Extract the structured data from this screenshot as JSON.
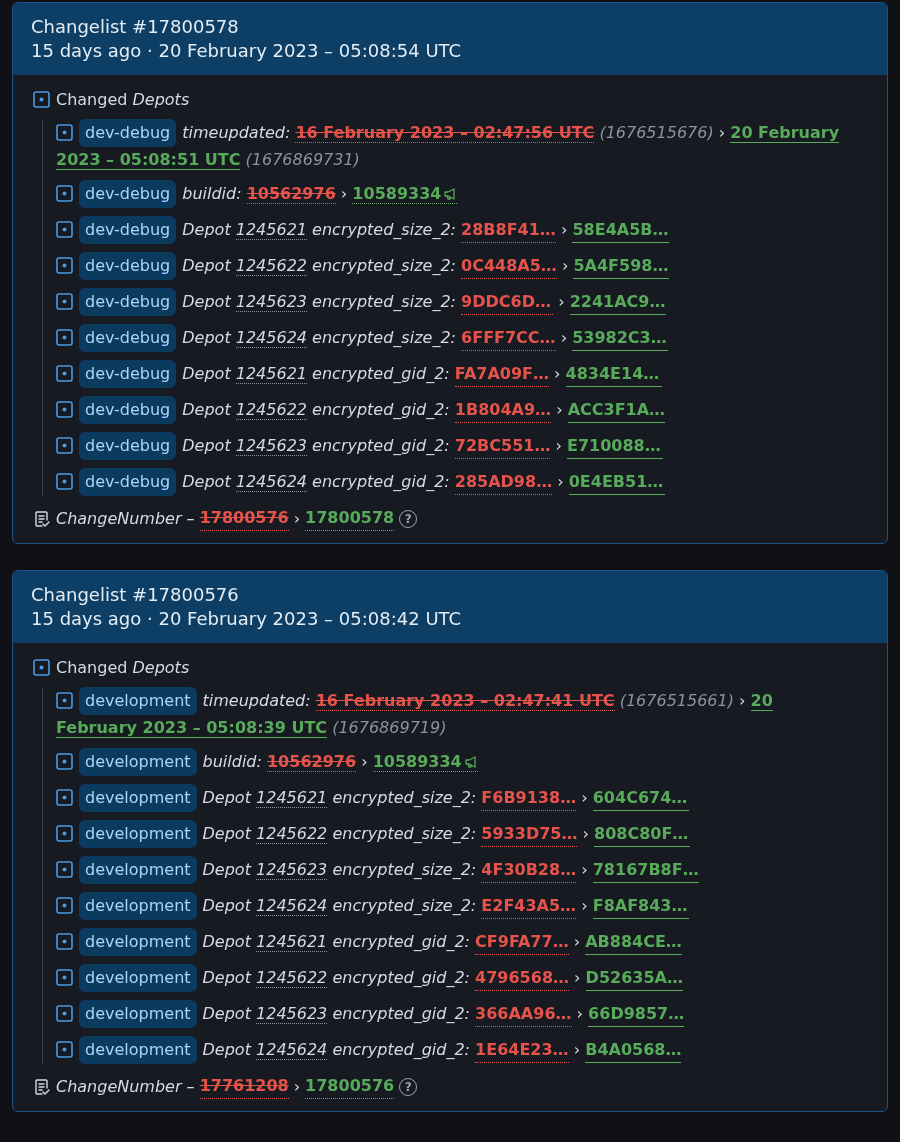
{
  "changelists": [
    {
      "title": "Changelist #17800578",
      "subtitle": "15 days ago · 20 February 2023 – 05:08:54 UTC",
      "section": {
        "label": "Changed",
        "label_italic": "Depots"
      },
      "changes": [
        {
          "kind": "time",
          "branch": "dev-debug",
          "key": "timeupdated:",
          "old": "16 February 2023 – 02:47:56 UTC",
          "old_note": "(1676515676)",
          "arrow": "›",
          "new": "20 February 2023 – 05:08:51 UTC",
          "new_note": "(1676869731)"
        },
        {
          "kind": "build",
          "branch": "dev-debug",
          "key": "buildid:",
          "old": "10562976",
          "arrow": "›",
          "new": "10589334"
        },
        {
          "kind": "depot",
          "branch": "dev-debug",
          "prefix": "Depot",
          "depot": "1245621",
          "key": "encrypted_size_2:",
          "old": "28B8F41…",
          "arrow": "›",
          "new": "58E4A5B…"
        },
        {
          "kind": "depot",
          "branch": "dev-debug",
          "prefix": "Depot",
          "depot": "1245622",
          "key": "encrypted_size_2:",
          "old": "0C448A5…",
          "arrow": "›",
          "new": "5A4F598…"
        },
        {
          "kind": "depot",
          "branch": "dev-debug",
          "prefix": "Depot",
          "depot": "1245623",
          "key": "encrypted_size_2:",
          "old": "9DDC6D…",
          "arrow": "›",
          "new": "2241AC9…"
        },
        {
          "kind": "depot",
          "branch": "dev-debug",
          "prefix": "Depot",
          "depot": "1245624",
          "key": "encrypted_size_2:",
          "old": "6FFF7CC…",
          "arrow": "›",
          "new": "53982C3…"
        },
        {
          "kind": "depot",
          "branch": "dev-debug",
          "prefix": "Depot",
          "depot": "1245621",
          "key": "encrypted_gid_2:",
          "old": "FA7A09F…",
          "arrow": "›",
          "new": "4834E14…"
        },
        {
          "kind": "depot",
          "branch": "dev-debug",
          "prefix": "Depot",
          "depot": "1245622",
          "key": "encrypted_gid_2:",
          "old": "1B804A9…",
          "arrow": "›",
          "new": "ACC3F1A…"
        },
        {
          "kind": "depot",
          "branch": "dev-debug",
          "prefix": "Depot",
          "depot": "1245623",
          "key": "encrypted_gid_2:",
          "old": "72BC551…",
          "arrow": "›",
          "new": "E710088…"
        },
        {
          "kind": "depot",
          "branch": "dev-debug",
          "prefix": "Depot",
          "depot": "1245624",
          "key": "encrypted_gid_2:",
          "old": "285AD98…",
          "arrow": "›",
          "new": "0E4EB51…"
        }
      ],
      "change_number": {
        "label": "ChangeNumber –",
        "old": "17800576",
        "arrow": "›",
        "new": "17800578",
        "help": "?"
      }
    },
    {
      "title": "Changelist #17800576",
      "subtitle": "15 days ago · 20 February 2023 – 05:08:42 UTC",
      "section": {
        "label": "Changed",
        "label_italic": "Depots"
      },
      "changes": [
        {
          "kind": "time",
          "branch": "development",
          "key": "timeupdated:",
          "old": "16 February 2023 – 02:47:41 UTC",
          "old_note": "(1676515661)",
          "arrow": "›",
          "new": "20 February 2023 – 05:08:39 UTC",
          "new_note": "(1676869719)"
        },
        {
          "kind": "build",
          "branch": "development",
          "key": "buildid:",
          "old": "10562976",
          "arrow": "›",
          "new": "10589334"
        },
        {
          "kind": "depot",
          "branch": "development",
          "prefix": "Depot",
          "depot": "1245621",
          "key": "encrypted_size_2:",
          "old": "F6B9138…",
          "arrow": "›",
          "new": "604C674…"
        },
        {
          "kind": "depot",
          "branch": "development",
          "prefix": "Depot",
          "depot": "1245622",
          "key": "encrypted_size_2:",
          "old": "5933D75…",
          "arrow": "›",
          "new": "808C80F…"
        },
        {
          "kind": "depot",
          "branch": "development",
          "prefix": "Depot",
          "depot": "1245623",
          "key": "encrypted_size_2:",
          "old": "4F30B28…",
          "arrow": "›",
          "new": "78167B8F…"
        },
        {
          "kind": "depot",
          "branch": "development",
          "prefix": "Depot",
          "depot": "1245624",
          "key": "encrypted_size_2:",
          "old": "E2F43A5…",
          "arrow": "›",
          "new": "F8AF843…"
        },
        {
          "kind": "depot",
          "branch": "development",
          "prefix": "Depot",
          "depot": "1245621",
          "key": "encrypted_gid_2:",
          "old": "CF9FA77…",
          "arrow": "›",
          "new": "AB884CE…"
        },
        {
          "kind": "depot",
          "branch": "development",
          "prefix": "Depot",
          "depot": "1245622",
          "key": "encrypted_gid_2:",
          "old": "4796568…",
          "arrow": "›",
          "new": "D52635A…"
        },
        {
          "kind": "depot",
          "branch": "development",
          "prefix": "Depot",
          "depot": "1245623",
          "key": "encrypted_gid_2:",
          "old": "366AA96…",
          "arrow": "›",
          "new": "66D9857…"
        },
        {
          "kind": "depot",
          "branch": "development",
          "prefix": "Depot",
          "depot": "1245624",
          "key": "encrypted_gid_2:",
          "old": "1E64E23…",
          "arrow": "›",
          "new": "B4A0568…"
        }
      ],
      "change_number": {
        "label": "ChangeNumber –",
        "old": "17761208",
        "arrow": "›",
        "new": "17800576",
        "help": "?"
      }
    }
  ]
}
